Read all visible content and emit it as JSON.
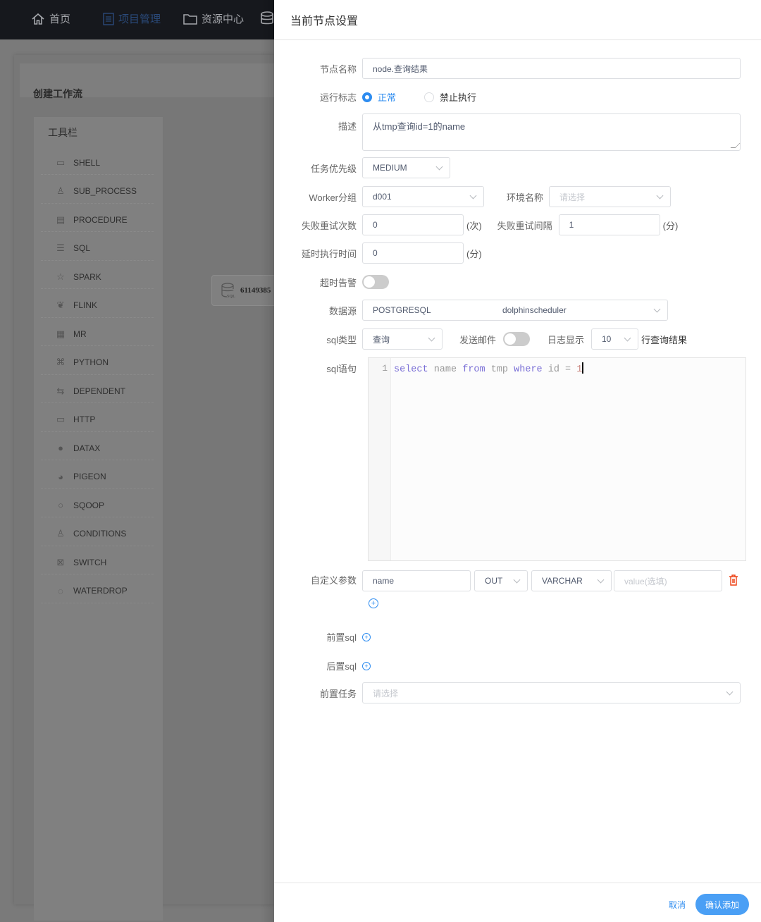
{
  "topnav": {
    "items": [
      {
        "label": "首页",
        "icon": "home-icon"
      },
      {
        "label": "项目管理",
        "icon": "project-icon",
        "active": true
      },
      {
        "label": "资源中心",
        "icon": "folder-icon"
      },
      {
        "label": "",
        "icon": "database-icon"
      }
    ]
  },
  "workflow": {
    "title": "创建工作流",
    "toolbar_title": "工具栏",
    "tools": [
      {
        "label": "SHELL",
        "icon": "shell-icon"
      },
      {
        "label": "SUB_PROCESS",
        "icon": "sub-process-icon"
      },
      {
        "label": "PROCEDURE",
        "icon": "procedure-icon"
      },
      {
        "label": "SQL",
        "icon": "sql-icon"
      },
      {
        "label": "SPARK",
        "icon": "spark-icon"
      },
      {
        "label": "FLINK",
        "icon": "flink-icon"
      },
      {
        "label": "MR",
        "icon": "mr-icon"
      },
      {
        "label": "PYTHON",
        "icon": "python-icon"
      },
      {
        "label": "DEPENDENT",
        "icon": "dependent-icon"
      },
      {
        "label": "HTTP",
        "icon": "http-icon"
      },
      {
        "label": "DATAX",
        "icon": "datax-icon"
      },
      {
        "label": "PIGEON",
        "icon": "pigeon-icon"
      },
      {
        "label": "SQOOP",
        "icon": "sqoop-icon"
      },
      {
        "label": "CONDITIONS",
        "icon": "conditions-icon"
      },
      {
        "label": "SWITCH",
        "icon": "switch-icon"
      },
      {
        "label": "WATERDROP",
        "icon": "waterdrop-icon"
      }
    ],
    "canvas_node": {
      "label": "61149385",
      "icon": "sql-icon"
    }
  },
  "drawer": {
    "title": "当前节点设置",
    "node_name": {
      "label": "节点名称",
      "value": "node.查询结果"
    },
    "run_flag": {
      "label": "运行标志",
      "options": [
        "正常",
        "禁止执行"
      ],
      "selected": "正常"
    },
    "description": {
      "label": "描述",
      "value": "从tmp查询id=1的name"
    },
    "priority": {
      "label": "任务优先级",
      "value": "MEDIUM"
    },
    "worker_group": {
      "label": "Worker分组",
      "value": "d001"
    },
    "environment": {
      "label": "环境名称",
      "placeholder": "请选择"
    },
    "retry_times": {
      "label": "失败重试次数",
      "value": "0",
      "unit": "(次)"
    },
    "retry_interval": {
      "label": "失败重试间隔",
      "value": "1",
      "unit": "(分)"
    },
    "delay_time": {
      "label": "延时执行时间",
      "value": "0",
      "unit": "(分)"
    },
    "timeout_alarm": {
      "label": "超时告警",
      "on": false
    },
    "datasource": {
      "label": "数据源",
      "type": "POSTGRESQL",
      "name": "dolphinscheduler"
    },
    "sql_type": {
      "label": "sql类型",
      "value": "查询"
    },
    "send_email": {
      "label": "发送邮件",
      "on": false
    },
    "log_display": {
      "label": "日志显示",
      "value": "10",
      "suffix": "行查询结果"
    },
    "sql_statement": {
      "label": "sql语句",
      "line_number": "1",
      "tokens": [
        {
          "t": "select",
          "kw": true
        },
        {
          "t": " name ",
          "kw": false
        },
        {
          "t": "from",
          "kw": true
        },
        {
          "t": " tmp ",
          "kw": false
        },
        {
          "t": "where",
          "kw": true
        },
        {
          "t": " id = ",
          "kw": false
        },
        {
          "t": "1",
          "num": true
        }
      ]
    },
    "custom_params": {
      "label": "自定义参数",
      "prop": "name",
      "direct": "OUT",
      "type": "VARCHAR",
      "value_placeholder": "value(选填)"
    },
    "pre_sql": {
      "label": "前置sql"
    },
    "post_sql": {
      "label": "后置sql"
    },
    "pre_tasks": {
      "label": "前置任务",
      "placeholder": "请选择"
    },
    "footer": {
      "cancel": "取消",
      "confirm": "确认添加"
    }
  },
  "colors": {
    "primary": "#2d8cf0",
    "danger": "#ed4014",
    "nav_bg": "#16181d"
  }
}
